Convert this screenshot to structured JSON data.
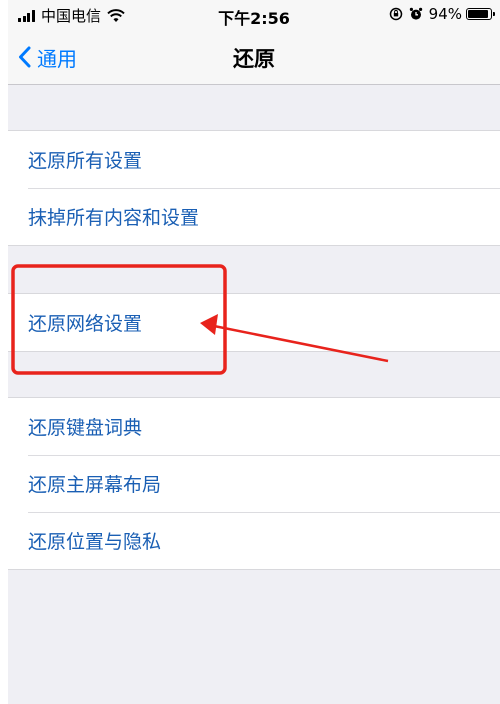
{
  "status_bar": {
    "carrier": "中国电信",
    "time": "下午2:56",
    "battery_percent": "94%",
    "battery_level": 0.94
  },
  "nav": {
    "back_label": "通用",
    "title": "还原"
  },
  "groups": [
    {
      "items": [
        "还原所有设置",
        "抹掉所有内容和设置"
      ]
    },
    {
      "items": [
        "还原网络设置"
      ]
    },
    {
      "items": [
        "还原键盘词典",
        "还原主屏幕布局",
        "还原位置与隐私"
      ]
    }
  ],
  "annotation": {
    "color": "#e8231c",
    "highlighted_item": "还原网络设置"
  },
  "colors": {
    "accent": "#007aff",
    "cell_text": "#1a5fb4",
    "background": "#efeff4"
  }
}
